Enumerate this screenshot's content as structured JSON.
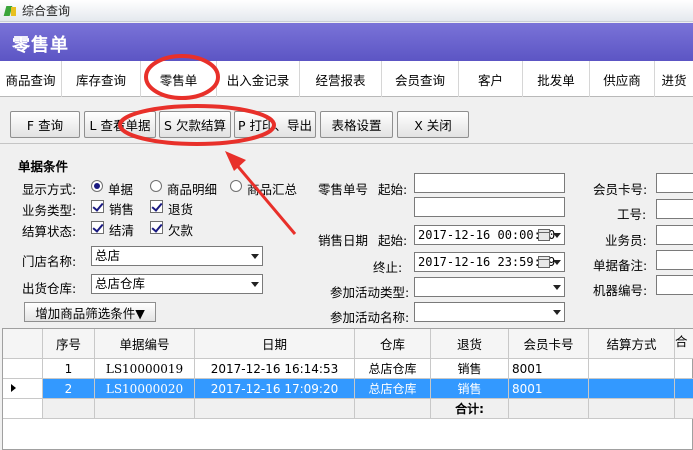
{
  "window": {
    "title": "综合查询"
  },
  "header": {
    "title": "零售单"
  },
  "nav_tabs": [
    "商品查询",
    "库存查询",
    "零售单",
    "出入金记录",
    "经营报表",
    "会员查询",
    "客户",
    "批发单",
    "供应商",
    "进货"
  ],
  "toolbar": {
    "query": "F 查询",
    "view_doc": "L 查看单据",
    "settle_debt": "S 欠款结算",
    "print_export": "P 打印、导出",
    "table_settings": "表格设置",
    "close": "X 关闭"
  },
  "conditions": {
    "section_title": "单据条件",
    "display_mode": {
      "label": "显示方式:",
      "options": [
        "单据",
        "商品明细",
        "商品汇总"
      ],
      "selected": 0
    },
    "business_type": {
      "label": "业务类型:",
      "options": [
        "销售",
        "退货"
      ],
      "checked": [
        true,
        true
      ]
    },
    "settle_status": {
      "label": "结算状态:",
      "options": [
        "结清",
        "欠款"
      ],
      "checked": [
        true,
        true
      ]
    },
    "store": {
      "label": "门店名称:",
      "value": "总店"
    },
    "warehouse": {
      "label": "出货仓库:",
      "value": "总店仓库"
    },
    "add_filter": "增加商品筛选条件▼",
    "doc_no_label": "零售单号",
    "start_label": "起始:",
    "end_label": "终止:",
    "sale_date_label": "销售日期",
    "sale_date_start": "2017-12-16 00:00:00",
    "sale_date_end": "2017-12-16 23:59:59",
    "activity_type_label": "参加活动类型:",
    "activity_name_label": "参加活动名称:",
    "member_card_label": "会员卡号:",
    "staff_no_label": "工号:",
    "salesman_label": "业务员:",
    "doc_remark_label": "单据备注:",
    "machine_no_label": "机器编号:"
  },
  "grid": {
    "columns": [
      "序号",
      "单据编号",
      "日期",
      "仓库",
      "退货",
      "会员卡号",
      "结算方式",
      "合"
    ],
    "rows": [
      [
        "1",
        "LS10000019",
        "2017-12-16  16:14:53",
        "总店仓库",
        "销售",
        "8001",
        ""
      ],
      [
        "2",
        "LS10000020",
        "2017-12-16  17:09:20",
        "总店仓库",
        "销售",
        "8001",
        ""
      ]
    ],
    "total_label": "合计:",
    "selected_row": 1
  },
  "colors": {
    "header": "#6a63d0",
    "selection": "#3399ff",
    "annotation": "#e8302a"
  }
}
